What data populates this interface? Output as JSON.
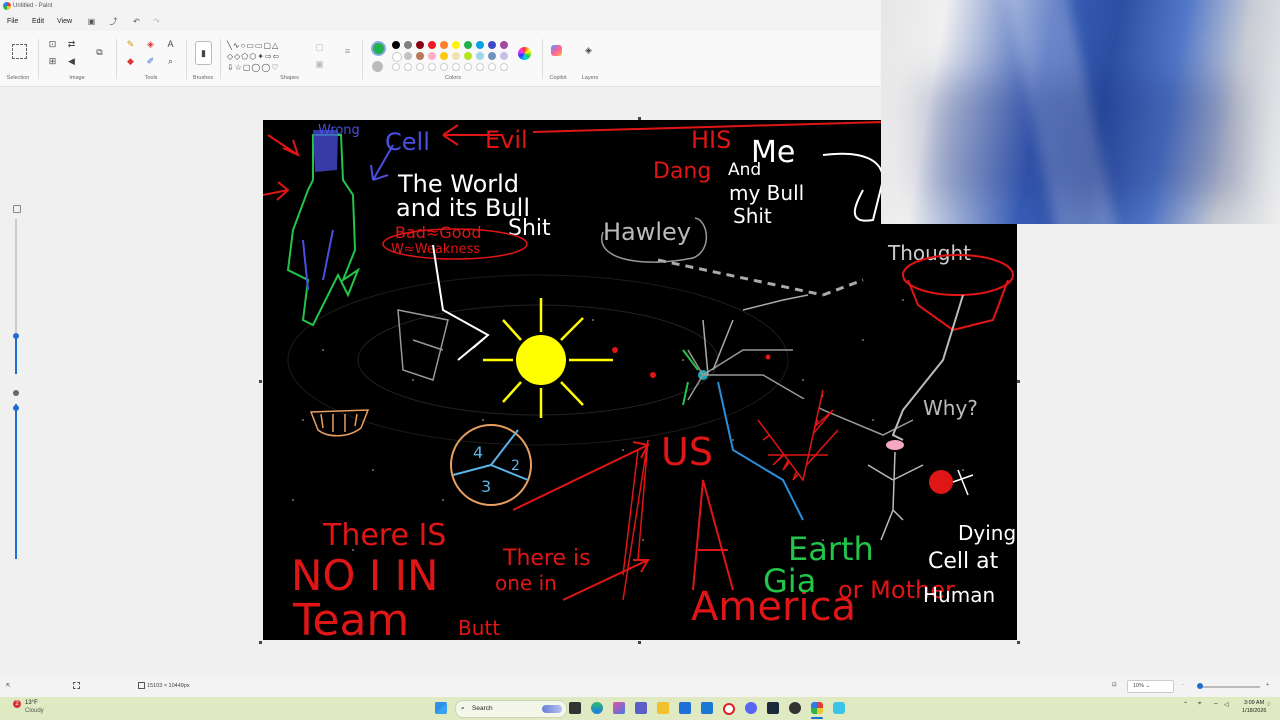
{
  "window": {
    "title": "Untitled - Paint"
  },
  "menu": {
    "file": "File",
    "edit": "Edit",
    "view": "View"
  },
  "ribbon": {
    "selection": "Selection",
    "image": "Image",
    "tools": "Tools",
    "brushes": "Brushes",
    "shapes": "Shapes",
    "colors": "Colors",
    "copilot": "Copilot",
    "layers": "Layers"
  },
  "palette": {
    "active_color": "#22b14c",
    "row1": [
      "#000000",
      "#7f7f7f",
      "#880015",
      "#ed1c24",
      "#ff7f27",
      "#fff200",
      "#22b14c",
      "#00a2e8",
      "#3f48cc",
      "#a349a4"
    ],
    "row2": [
      "#ffffff",
      "#c3c3c3",
      "#b97a57",
      "#ffaec9",
      "#ffc90e",
      "#efe4b0",
      "#b5e61d",
      "#99d9ea",
      "#7092be",
      "#c8bfe7"
    ]
  },
  "canvas": {
    "text": {
      "wrong": "Wrong",
      "cell": "Cell",
      "evil": "Evil",
      "his": "HIS",
      "dang": "Dang",
      "me": "Me",
      "and": "And",
      "my_bull": "my Bull",
      "shit2": "Shit",
      "world1": "The World",
      "world2": "and its Bull",
      "world3": "Shit",
      "bad_good": "Bad≈Good",
      "weakness": "W≈Weakness",
      "hawley": "Hawley",
      "thought": "Thought",
      "why": "Why?",
      "us": "US",
      "there_is": "There IS",
      "no_i_in": "NO I IN",
      "team": "Team",
      "there_is2": "There is",
      "one_in": "one in",
      "butt": "Butt",
      "america": "America",
      "earth": "Earth",
      "gia": "Gia",
      "or_mother": "or Mother",
      "dying": "Dying",
      "cell2": "Cell at",
      "human": "Human",
      "n4": "4",
      "n2": "2",
      "n3": "3"
    }
  },
  "status": {
    "dimensions": "15103 × 10449px",
    "zoom": "10%"
  },
  "taskbar": {
    "weather_temp": "13°F",
    "weather_desc": "Cloudy",
    "search_label": "Search",
    "time": "3:09 AM",
    "date": "1/18/2026"
  }
}
